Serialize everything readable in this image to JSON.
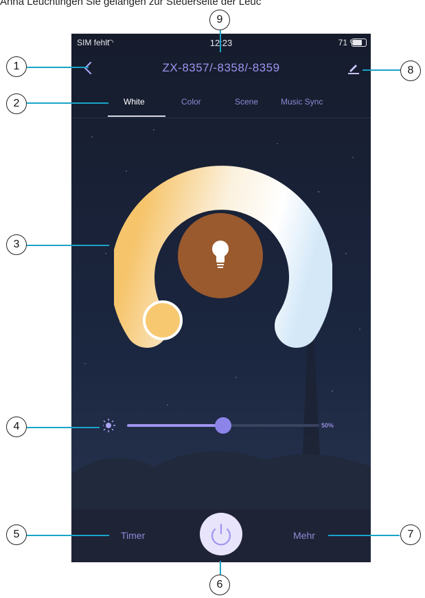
{
  "caption": "Anna Leuchtingen Sie gelangen zur Steuerseite der Leuc",
  "status_bar": {
    "carrier": "SIM fehlt",
    "time": "12:23",
    "battery": "71 %"
  },
  "header": {
    "title": "ZX-8357/-8358/-8359"
  },
  "tabs": [
    {
      "label": "White",
      "active": true
    },
    {
      "label": "Color"
    },
    {
      "label": "Scene"
    },
    {
      "label": "Music Sync"
    }
  ],
  "brightness": {
    "value_label": "50%",
    "level": 0.5
  },
  "bottom": {
    "timer_label": "Timer",
    "more_label": "Mehr"
  },
  "callouts": [
    "1",
    "2",
    "3",
    "4",
    "5",
    "6",
    "7",
    "8",
    "9"
  ],
  "colors": {
    "accent": "#9d94f0",
    "leader": "#1aa3c7",
    "bulb_center": "#9a5a2e",
    "background": "#131a2b"
  },
  "icons": {
    "back": "chevron-left-icon",
    "edit": "pencil-icon",
    "brightness": "sun-icon",
    "bulb": "lightbulb-icon",
    "power": "power-icon"
  }
}
